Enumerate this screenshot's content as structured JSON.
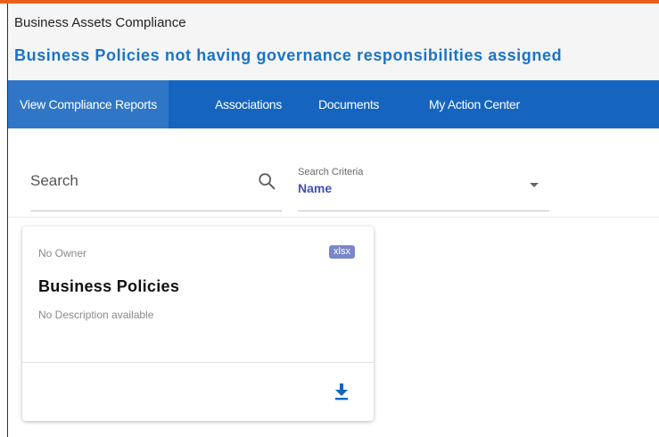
{
  "app": {
    "title": "Business Assets Compliance",
    "page_title": "Business Policies not having governance responsibilities assigned"
  },
  "nav": {
    "items": [
      {
        "label": "View Compliance Reports",
        "active": true
      },
      {
        "label": "Associations",
        "active": false
      },
      {
        "label": "Documents",
        "active": false
      },
      {
        "label": "My Action Center",
        "active": false
      }
    ]
  },
  "search": {
    "placeholder": "Search",
    "value": "",
    "icon": "search-icon"
  },
  "criteria": {
    "label": "Search Criteria",
    "value": "Name"
  },
  "card": {
    "owner": "No Owner",
    "badge": "xlsx",
    "title": "Business Policies",
    "description": "No Description available",
    "action_icon": "download-icon"
  },
  "colors": {
    "accent": "#e8601c",
    "nav_background": "#1565c0",
    "nav_active": "#2f77c6",
    "page_title": "#1a73c9",
    "badge": "#7986cb",
    "criteria_value": "#3f51b5",
    "download_icon": "#1565c0"
  }
}
